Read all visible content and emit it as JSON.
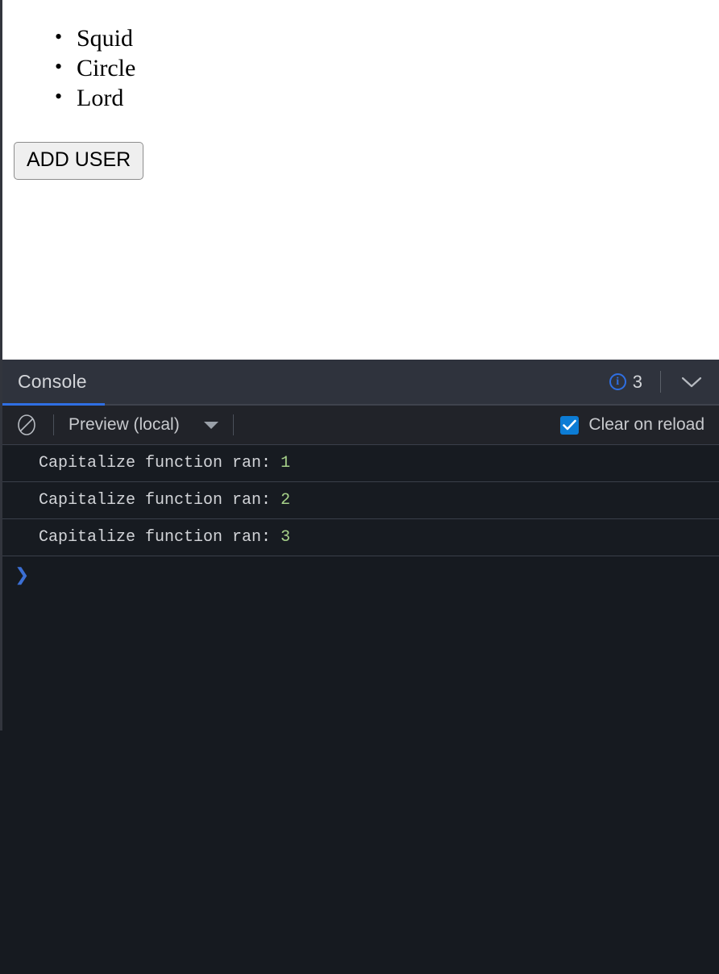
{
  "preview": {
    "users": [
      "Squid",
      "Circle",
      "Lord"
    ],
    "add_user_label": "ADD USER"
  },
  "console": {
    "tab_label": "Console",
    "info_icon": "info-circle-icon",
    "info_count": "3",
    "collapse_icon": "chevron-down-icon",
    "toolbar": {
      "clear_icon": "clear-console-icon",
      "context_label": "Preview (local)",
      "context_caret": "caret-down-icon",
      "clear_on_reload_label": "Clear on reload",
      "clear_on_reload_checked": true
    },
    "logs": [
      {
        "message": "Capitalize function ran: ",
        "value": "1"
      },
      {
        "message": "Capitalize function ran: ",
        "value": "2"
      },
      {
        "message": "Capitalize function ran: ",
        "value": "3"
      }
    ],
    "prompt_symbol": "❯"
  },
  "colors": {
    "accent_blue": "#2f6fe3",
    "checkbox_blue": "#0c7cd5",
    "log_value_green": "#a6d189",
    "header_bg": "#2f333d",
    "toolbar_bg": "#212329",
    "console_bg": "#161a20",
    "log_row_bg": "#171b21"
  }
}
